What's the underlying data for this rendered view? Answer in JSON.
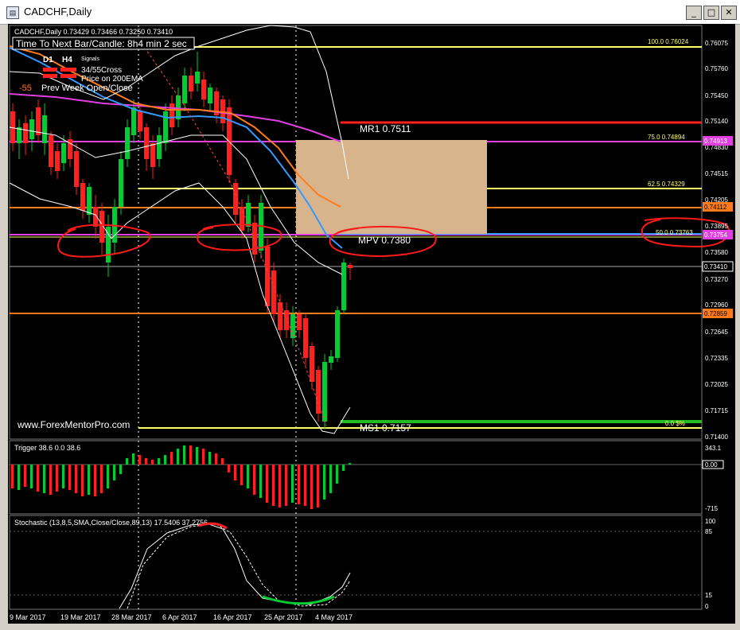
{
  "window": {
    "title": "CADCHF,Daily",
    "buttons": {
      "minimize": "_",
      "maximize": "□",
      "close": "✕"
    }
  },
  "header": {
    "symbol_info": "CADCHF,Daily  0.73429 0.73466 0.73250 0.73410",
    "timer": "Time To Next Bar/Candle: 8h4 min 2 sec",
    "tf1": "D1",
    "tf2": "H4",
    "signals": "Signals",
    "legend1": "34/55Cross",
    "legend2": "Price on 200EMA",
    "prev_week_num": "-55",
    "prev_week_label": "Prev Week Open/Close"
  },
  "watermark": "www.ForexMentorPro.com",
  "pivot_labels": {
    "mr1": "MR1  0.7511",
    "mpv": "MPV  0.7380",
    "ms1": "MS1  0.7157"
  },
  "fib_labels": [
    "100.0  0.76024",
    "75.0  0.74894",
    "62.5  0.74329",
    "50.0  0.73763",
    "0.0  $%"
  ],
  "price_axis": [
    "0.76075",
    "0.75760",
    "0.75450",
    "0.75140",
    "0.74830",
    "0.74515",
    "0.74205",
    "0.73895",
    "0.73580",
    "0.73270",
    "0.72960",
    "0.72645",
    "0.72335",
    "0.72025",
    "0.71715",
    "0.71400"
  ],
  "price_tags": {
    "t1": "0.74913",
    "t2": "0.74112",
    "t3": "0.73754",
    "current": "0.73410",
    "t4": "0.72859"
  },
  "trigger": {
    "label": "Trigger 38.6 0.0 38.6",
    "axis_top": "343.1",
    "axis_zero": "0.00",
    "axis_bottom": "-715"
  },
  "stochastic": {
    "label": "Stochastic (13,8,5,SMA,Close/Close,89,13) 17.5406 37.2756",
    "levels": [
      "100",
      "85",
      "15",
      "0"
    ]
  },
  "x_axis": [
    "9 Mar 2017",
    "19 Mar 2017",
    "28 Mar 2017",
    "6 Apr 2017",
    "16 Apr 2017",
    "25 Apr 2017",
    "4 May 2017"
  ],
  "colors": {
    "bull": "#00cc33",
    "bear": "#ff2020",
    "magenta": "#e040e0",
    "orange": "#ff7a1a",
    "yellow": "#ffff66",
    "blue": "#3399ff",
    "zone": "#d8b48c",
    "annotation": "#ff1a1a"
  }
}
